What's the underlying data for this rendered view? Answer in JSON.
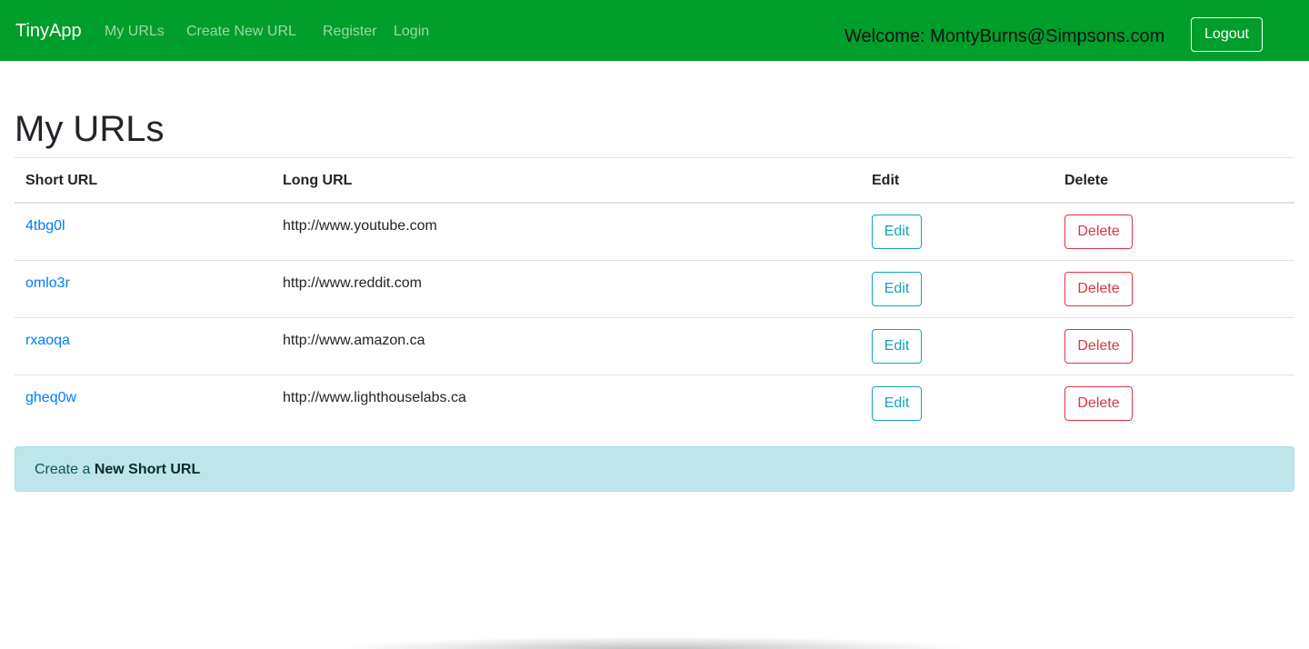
{
  "navbar": {
    "brand": "TinyApp",
    "links": [
      {
        "label": "My URLs"
      },
      {
        "label": "Create New URL"
      },
      {
        "label": "Register"
      },
      {
        "label": "Login"
      }
    ],
    "welcome": "Welcome: MontyBurns@Simpsons.com",
    "logout_label": "Logout",
    "color": "#009e2a"
  },
  "main": {
    "title": "My URLs",
    "table": {
      "headers": [
        "Short URL",
        "Long URL",
        "Edit",
        "Delete"
      ],
      "rows": [
        {
          "short": "4tbg0l",
          "long": "http://www.youtube.com",
          "edit": "Edit",
          "delete": "Delete"
        },
        {
          "short": "omlo3r",
          "long": "http://www.reddit.com",
          "edit": "Edit",
          "delete": "Delete"
        },
        {
          "short": "rxaoqa",
          "long": "http://www.amazon.ca",
          "edit": "Edit",
          "delete": "Delete"
        },
        {
          "short": "gheq0w",
          "long": "http://www.lighthouselabs.ca",
          "edit": "Edit",
          "delete": "Delete"
        }
      ]
    },
    "alert": {
      "prefix": "Create a ",
      "link": "New Short URL"
    }
  }
}
